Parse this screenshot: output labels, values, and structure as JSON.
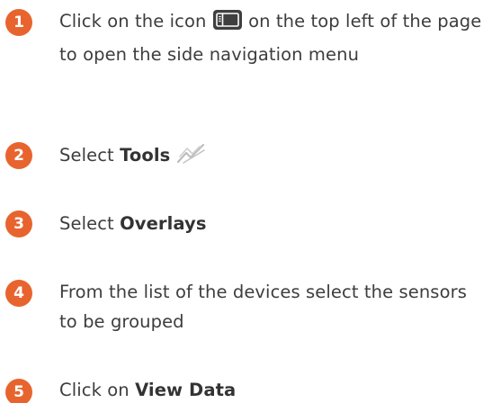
{
  "accent_color": "#e8642e",
  "steps": [
    {
      "number": "1",
      "text_before": "Click on the icon",
      "icon": "side-panel-icon",
      "text_after": "on the top left of the page to open the side navigation menu"
    },
    {
      "number": "2",
      "text_before": "Select",
      "bold": "Tools",
      "icon": "tools-chart-icon"
    },
    {
      "number": "3",
      "text_before": "Select",
      "bold": "Overlays"
    },
    {
      "number": "4",
      "text_before": "From the list of the devices select the sensors to be grouped"
    },
    {
      "number": "5",
      "text_before": "Click on",
      "bold": "View Data"
    }
  ]
}
